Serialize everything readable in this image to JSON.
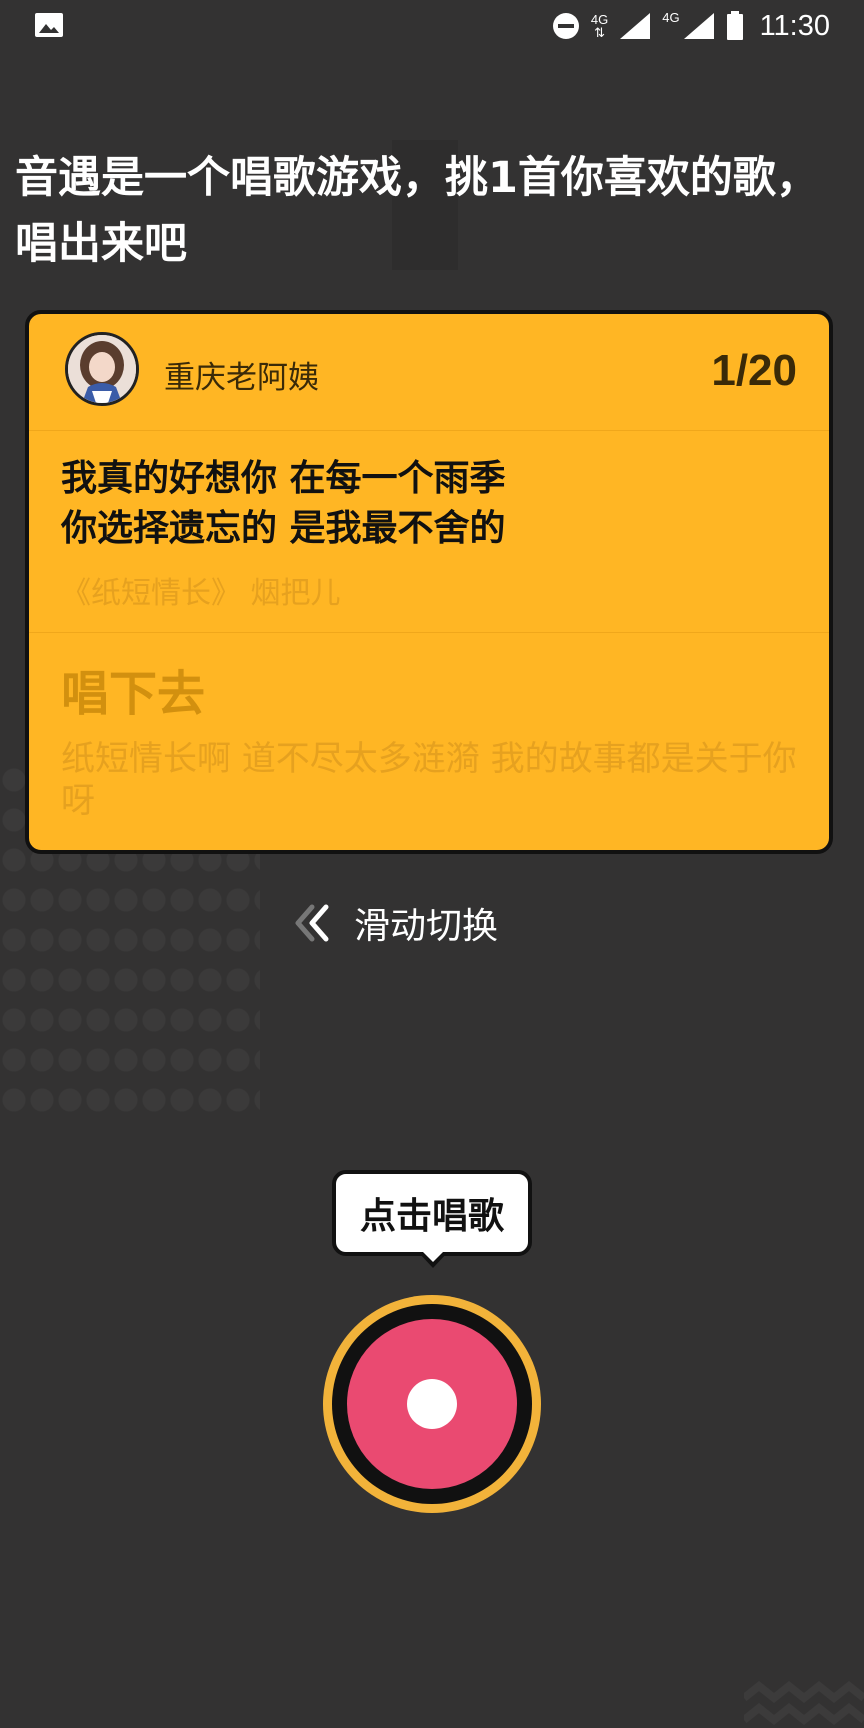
{
  "status_bar": {
    "network_label_1": "4G",
    "network_label_2": "4G",
    "time": "11:30"
  },
  "headline": "音遇是一个唱歌游戏，挑1首你喜欢的歌，唱出来吧",
  "card": {
    "username": "重庆老阿姨",
    "page_counter": "1/20",
    "current_lyric_line_1": "我真的好想你 在每一个雨季",
    "current_lyric_line_2": "你选择遗忘的 是我最不舍的",
    "song_source": "《纸短情长》 烟把儿",
    "next_label": "唱下去",
    "next_lyric": "纸短情长啊 道不尽太多涟漪 我的故事都是关于你呀"
  },
  "swipe_hint": {
    "text": "滑动切换",
    "icon": "double-chevron-left-icon"
  },
  "tooltip": {
    "text": "点击唱歌"
  },
  "colors": {
    "background": "#333232",
    "card": "#ffb624",
    "record_core": "#ea4a71",
    "record_ring": "#f2b33a"
  }
}
